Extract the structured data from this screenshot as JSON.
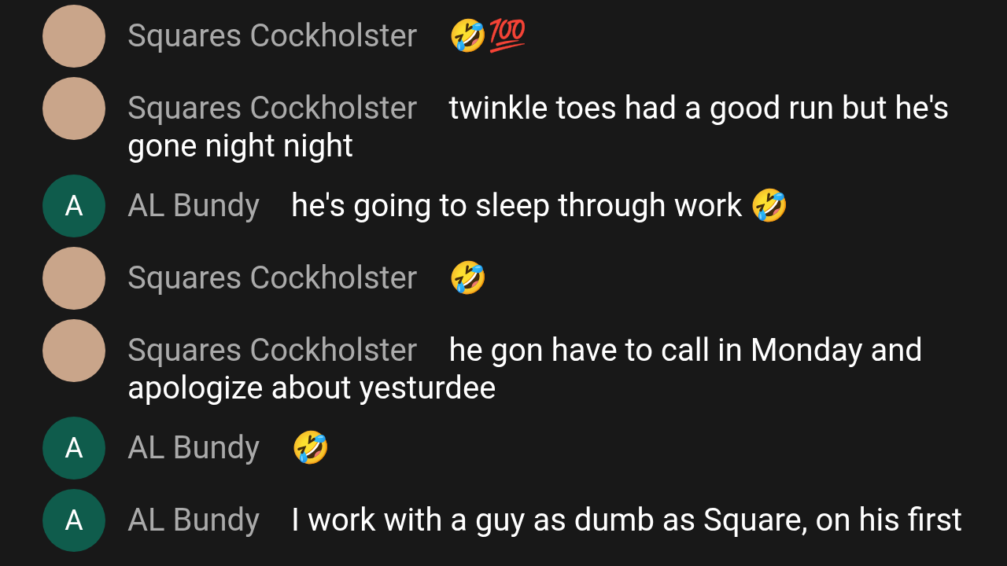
{
  "messages": [
    {
      "author": "Squares Cockholster",
      "avatar": {
        "kind": "photo"
      },
      "text": "🤣💯"
    },
    {
      "author": "Squares Cockholster",
      "avatar": {
        "kind": "photo"
      },
      "text": "twinkle toes had a good run but he's gone night night"
    },
    {
      "author": "AL Bundy",
      "avatar": {
        "kind": "letter",
        "letter": "A"
      },
      "text": "he's going to sleep through work 🤣"
    },
    {
      "author": "Squares Cockholster",
      "avatar": {
        "kind": "photo"
      },
      "text": "🤣"
    },
    {
      "author": "Squares Cockholster",
      "avatar": {
        "kind": "photo"
      },
      "text": "he gon have to call in Monday and apologize about yesturdee"
    },
    {
      "author": "AL Bundy",
      "avatar": {
        "kind": "letter",
        "letter": "A"
      },
      "text": "🤣"
    },
    {
      "author": "AL Bundy",
      "avatar": {
        "kind": "letter",
        "letter": "A"
      },
      "text": "I work with a guy as dumb as Square, on his first"
    }
  ]
}
